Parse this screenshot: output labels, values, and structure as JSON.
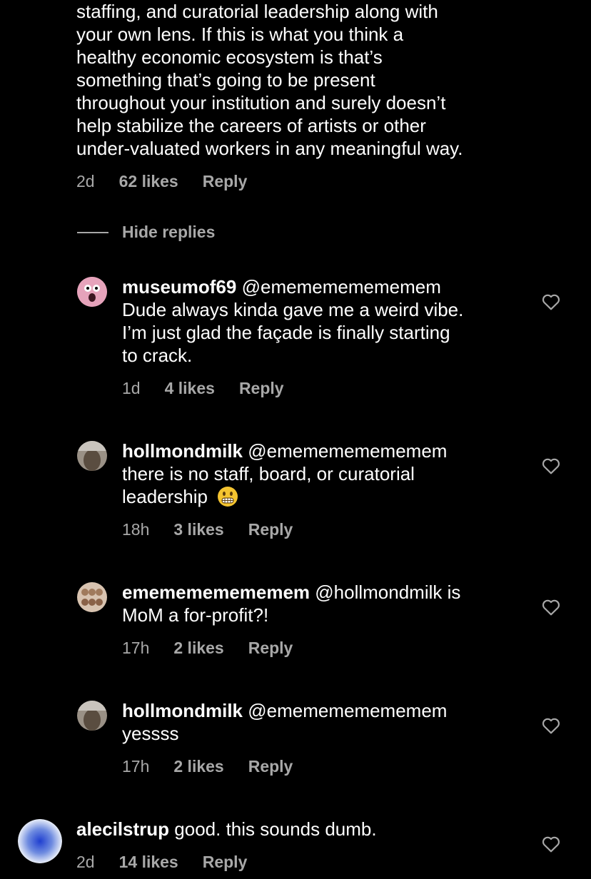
{
  "top_comment": {
    "lines": [
      "staffing, and curatorial leadership along with",
      "your own lens. If this is what you think a",
      "healthy economic ecosystem is that’s",
      "something that’s going to be present",
      "throughout your institution and surely doesn’t",
      "help stabilize the careers of artists or other",
      "under-valuated workers in any meaningful way."
    ],
    "time": "2d",
    "likes": "62 likes",
    "reply": "Reply"
  },
  "hide_replies": "Hide replies",
  "replies": [
    {
      "username": "museumof69",
      "mention": "@ememememememem",
      "lines": [
        "Dude always kinda gave me a weird vibe.",
        "I’m just glad the façade is finally starting",
        "to crack."
      ],
      "time": "1d",
      "likes": "4 likes",
      "reply": "Reply",
      "avatar_icon": "pink-face-avatar"
    },
    {
      "username": "hollmondmilk",
      "mention": "@ememememememem",
      "lines": [
        "there is no staff, board, or curatorial",
        "leadership"
      ],
      "emoji": "grimacing-face-emoji",
      "time": "18h",
      "likes": "3 likes",
      "reply": "Reply",
      "avatar_icon": "photo-avatar"
    },
    {
      "username": "ememememememem",
      "mention": "@hollmondmilk",
      "mention_tail": "is",
      "lines": [
        "MoM a for-profit?!"
      ],
      "time": "17h",
      "likes": "2 likes",
      "reply": "Reply",
      "avatar_icon": "photo-avatar"
    },
    {
      "username": "hollmondmilk",
      "mention": "@ememememememem",
      "lines": [
        "yessss"
      ],
      "time": "17h",
      "likes": "2 likes",
      "reply": "Reply",
      "avatar_icon": "photo-avatar"
    }
  ],
  "bottom_comment": {
    "username": "alecilstrup",
    "text": "good. this sounds dumb.",
    "time": "2d",
    "likes": "14 likes",
    "reply": "Reply",
    "avatar_icon": "blue-gradient-avatar"
  },
  "icons": {
    "like": "heart-outline-icon"
  },
  "colors": {
    "background": "#000000",
    "text": "#ffffff",
    "secondary": "#a8a8a8"
  }
}
